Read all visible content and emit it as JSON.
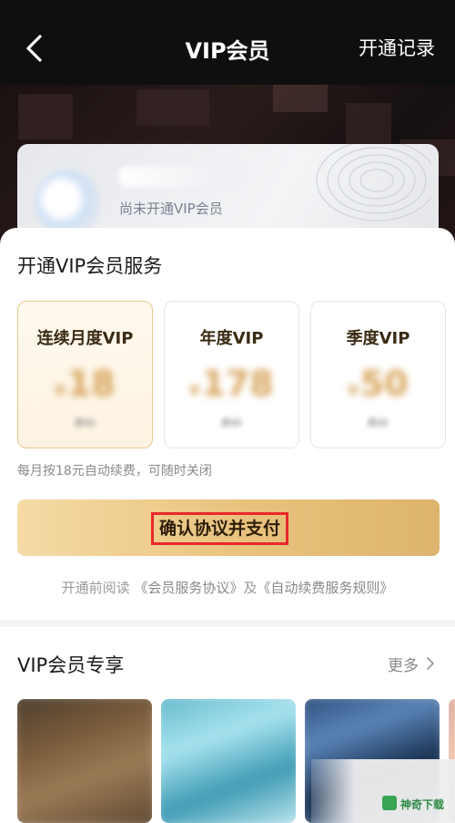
{
  "nav": {
    "title": "VIP会员",
    "right_action": "开通记录",
    "back_icon": "back-arrow-icon"
  },
  "member_card": {
    "status": "尚未开通VIP会员"
  },
  "purchase": {
    "section_title": "开通VIP会员服务",
    "plans": [
      {
        "name": "连续月度VIP",
        "price": "18",
        "original": "原价",
        "selected": true
      },
      {
        "name": "年度VIP",
        "price": "178",
        "original": "原价",
        "selected": false
      },
      {
        "name": "季度VIP",
        "price": "50",
        "original": "原价",
        "selected": false
      }
    ],
    "currency_symbol": "¥",
    "renew_note": "每月按18元自动续费，可随时关闭",
    "pay_button_label": "确认协议并支付",
    "agreement": {
      "prefix": "开通前阅读",
      "service_link": "《会员服务协议》",
      "joiner": "及",
      "renew_link": "《自动续费服务规则》"
    }
  },
  "exclusive": {
    "title": "VIP会员专享",
    "more_label": "更多"
  },
  "watermark": {
    "text": "神奇下载"
  },
  "colors": {
    "accent_gold": "#e8c27c",
    "highlight_red": "#e8282b",
    "nav_bg": "#0f0f0f"
  }
}
